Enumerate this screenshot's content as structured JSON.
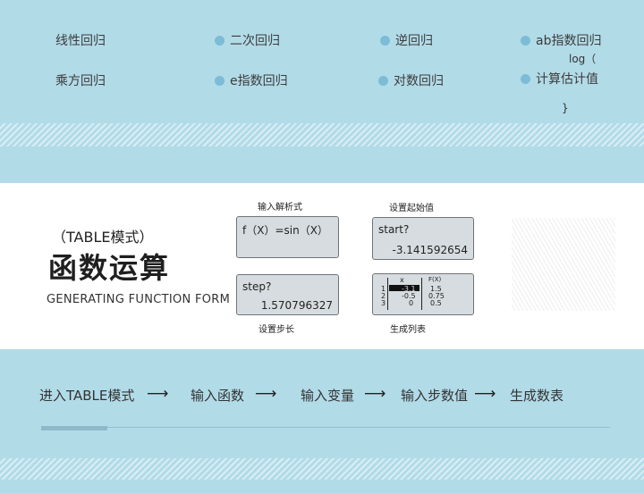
{
  "menu": {
    "linear": "线性回归",
    "quadratic": "二次回归",
    "inverse": "逆回归",
    "ab_exp": "ab指数回归",
    "log_open": "log（",
    "power": "乘方回归",
    "e_exp": "e指数回归",
    "logarithmic": "对数回归",
    "estimate": "计算估计值",
    "brace": "}"
  },
  "table_section": {
    "mode": "（TABLE模式）",
    "title": "函数运算",
    "subtitle": "GENERATING FUNCTION FORM",
    "cap_formula": "输入解析式",
    "cap_start": "设置起始值",
    "cap_step": "设置步长",
    "cap_table": "生成列表",
    "screen_formula": "f（X）=sin（X）",
    "screen_start_label": "start?",
    "screen_start_value": "-3.141592654",
    "screen_step_label": "step?",
    "screen_step_value": "1.570796327",
    "table_header_x": "x",
    "table_header_fx": "F(X)",
    "table_rows": [
      {
        "n": "1",
        "x": "-3.1",
        "fx": "1.5"
      },
      {
        "n": "2",
        "x": "-0.5",
        "fx": "0.75"
      },
      {
        "n": "3",
        "x": "0",
        "fx": "0.5"
      }
    ]
  },
  "flow": {
    "step1": "进入TABLE模式",
    "step2": "输入函数",
    "step3": "输入变量",
    "step4": "输入步数值",
    "step5": "生成数表"
  },
  "colors": {
    "light_blue": "#b2dbe8",
    "dot_blue": "#7cbcd6",
    "screen_gray": "#d6dcdf"
  }
}
